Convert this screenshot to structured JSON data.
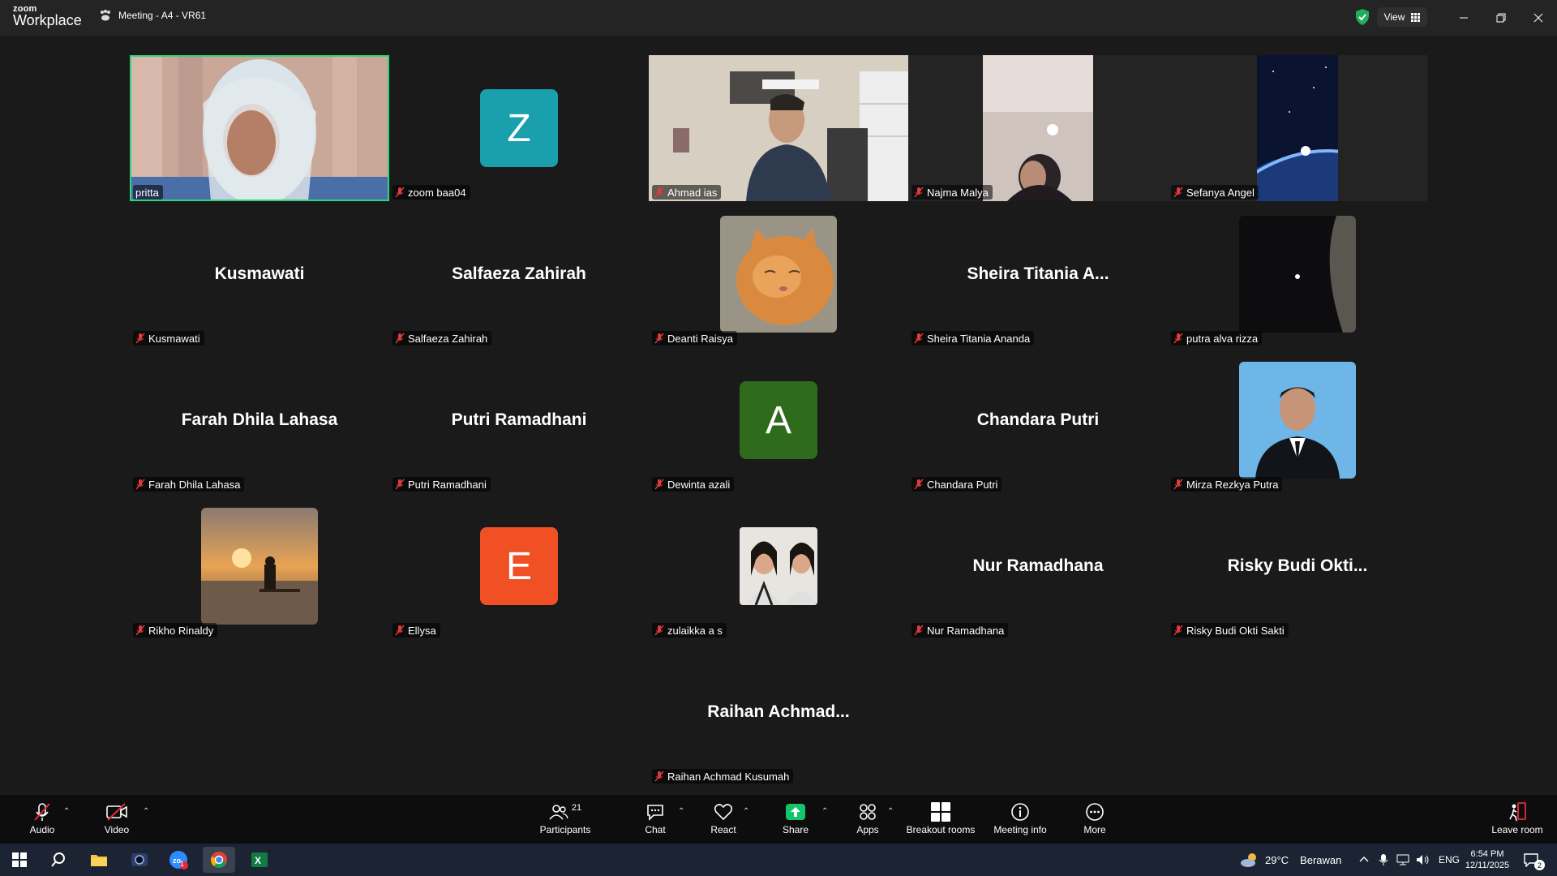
{
  "app": {
    "logo_top": "zoom",
    "logo_bottom": "Workplace",
    "meeting_title": "Meeting - A4 - VR61",
    "view_label": "View"
  },
  "colors": {
    "speaker_border": "#2fd47f",
    "avatar_z": "#1a9fac",
    "avatar_a": "#2f6b1c",
    "avatar_e": "#f05023",
    "share_green": "#12c46b",
    "leave_red": "#e8293b"
  },
  "participants": [
    {
      "name": "pritta",
      "display": "",
      "kind": "video"
    },
    {
      "name": "zoom baa04",
      "display": "Z",
      "kind": "avatar"
    },
    {
      "name": "Ahmad ias",
      "display": "",
      "kind": "video"
    },
    {
      "name": "Najma Malya",
      "display": "",
      "kind": "video"
    },
    {
      "name": "Sefanya Angel",
      "display": "",
      "kind": "video"
    },
    {
      "name": "Kusmawati",
      "display": "Kusmawati",
      "kind": "text"
    },
    {
      "name": "Salfaeza Zahirah",
      "display": "Salfaeza Zahirah",
      "kind": "text"
    },
    {
      "name": "Deanti Raisya",
      "display": "",
      "kind": "photo"
    },
    {
      "name": "Sheira Titania Ananda",
      "display": "Sheira Titania A...",
      "kind": "text"
    },
    {
      "name": "putra alva rizza",
      "display": "",
      "kind": "photo"
    },
    {
      "name": "Farah Dhila Lahasa",
      "display": "Farah Dhila Lahasa",
      "kind": "text"
    },
    {
      "name": "Putri Ramadhani",
      "display": "Putri Ramadhani",
      "kind": "text"
    },
    {
      "name": "Dewinta azali",
      "display": "A",
      "kind": "avatar"
    },
    {
      "name": "Chandara Putri",
      "display": "Chandara Putri",
      "kind": "text"
    },
    {
      "name": "Mirza Rezkya Putra",
      "display": "",
      "kind": "photo"
    },
    {
      "name": "Rikho Rinaldy",
      "display": "",
      "kind": "photo"
    },
    {
      "name": "Ellysa",
      "display": "E",
      "kind": "avatar"
    },
    {
      "name": "zulaikka a s",
      "display": "",
      "kind": "photo"
    },
    {
      "name": "Nur Ramadhana",
      "display": "Nur Ramadhana",
      "kind": "text"
    },
    {
      "name": "Risky Budi Okti Sakti",
      "display": "Risky Budi Okti...",
      "kind": "text"
    },
    {
      "name": "Raihan Achmad Kusumah",
      "display": "Raihan Achmad...",
      "kind": "text"
    }
  ],
  "toolbar": {
    "audio": "Audio",
    "video": "Video",
    "participants": "Participants",
    "participants_count": "21",
    "chat": "Chat",
    "react": "React",
    "share": "Share",
    "apps": "Apps",
    "breakout": "Breakout rooms",
    "meeting_info": "Meeting info",
    "more": "More",
    "leave": "Leave room"
  },
  "taskbar": {
    "weather_temp": "29°C",
    "weather_desc": "Berawan",
    "lang": "ENG",
    "time": "6:54 PM",
    "date": "12/11/2025",
    "notif_count": "2",
    "zoom_badge": "1"
  }
}
